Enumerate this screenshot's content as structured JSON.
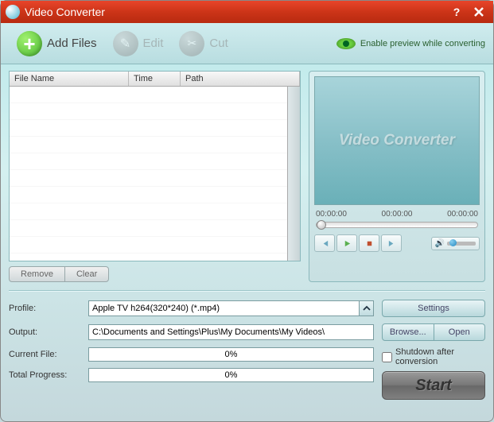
{
  "titlebar": {
    "title": "Video Converter"
  },
  "toolbar": {
    "add_files": "Add Files",
    "edit": "Edit",
    "cut": "Cut",
    "preview_toggle": "Enable preview while converting"
  },
  "file_table": {
    "headers": {
      "filename": "File Name",
      "time": "Time",
      "path": "Path"
    },
    "rows": []
  },
  "file_actions": {
    "remove": "Remove",
    "clear": "Clear"
  },
  "preview": {
    "watermark": "Video Converter",
    "time_start": "00:00:00",
    "time_mid": "00:00:00",
    "time_end": "00:00:00"
  },
  "profile": {
    "label": "Profile:",
    "value": "Apple TV h264(320*240) (*.mp4)",
    "settings_btn": "Settings"
  },
  "output": {
    "label": "Output:",
    "value": "C:\\Documents and Settings\\Plus\\My Documents\\My Videos\\",
    "browse_btn": "Browse...",
    "open_btn": "Open"
  },
  "progress": {
    "current_label": "Current File:",
    "current_value": "0%",
    "total_label": "Total Progress:",
    "total_value": "0%"
  },
  "options": {
    "shutdown_label": "Shutdown after conversion",
    "start_btn": "Start"
  }
}
